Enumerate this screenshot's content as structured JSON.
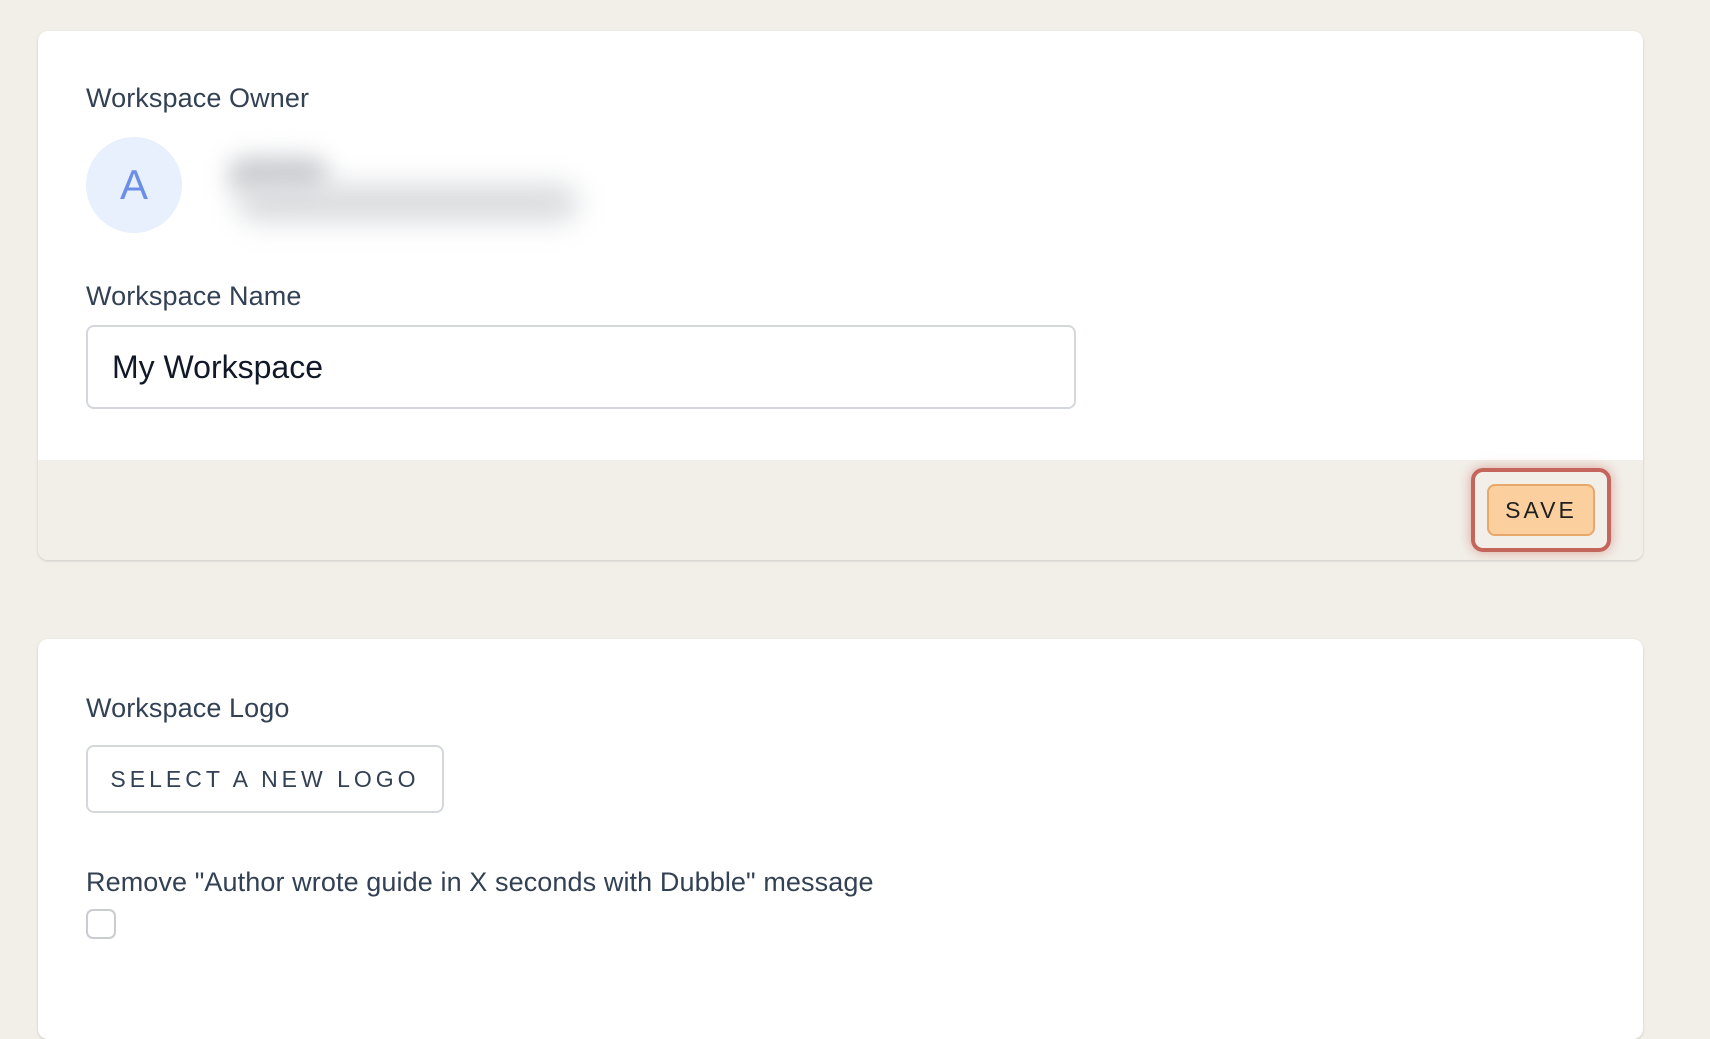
{
  "owner_section": {
    "owner_label": "Workspace Owner",
    "avatar_initial": "A",
    "name_label": "Workspace Name",
    "name_value": "My Workspace",
    "save_label": "SAVE"
  },
  "logo_section": {
    "logo_label": "Workspace Logo",
    "select_logo_label": "SELECT A NEW LOGO",
    "remove_message_label": "Remove \"Author wrote guide in X seconds with Dubble\" message",
    "remove_message_checked": false
  },
  "colors": {
    "page_background": "#f2efe9",
    "save_button_fill": "#fcd09e",
    "focus_highlight": "#c5665c",
    "avatar_background": "#e8f0fd",
    "avatar_text": "#6b8fe6"
  }
}
